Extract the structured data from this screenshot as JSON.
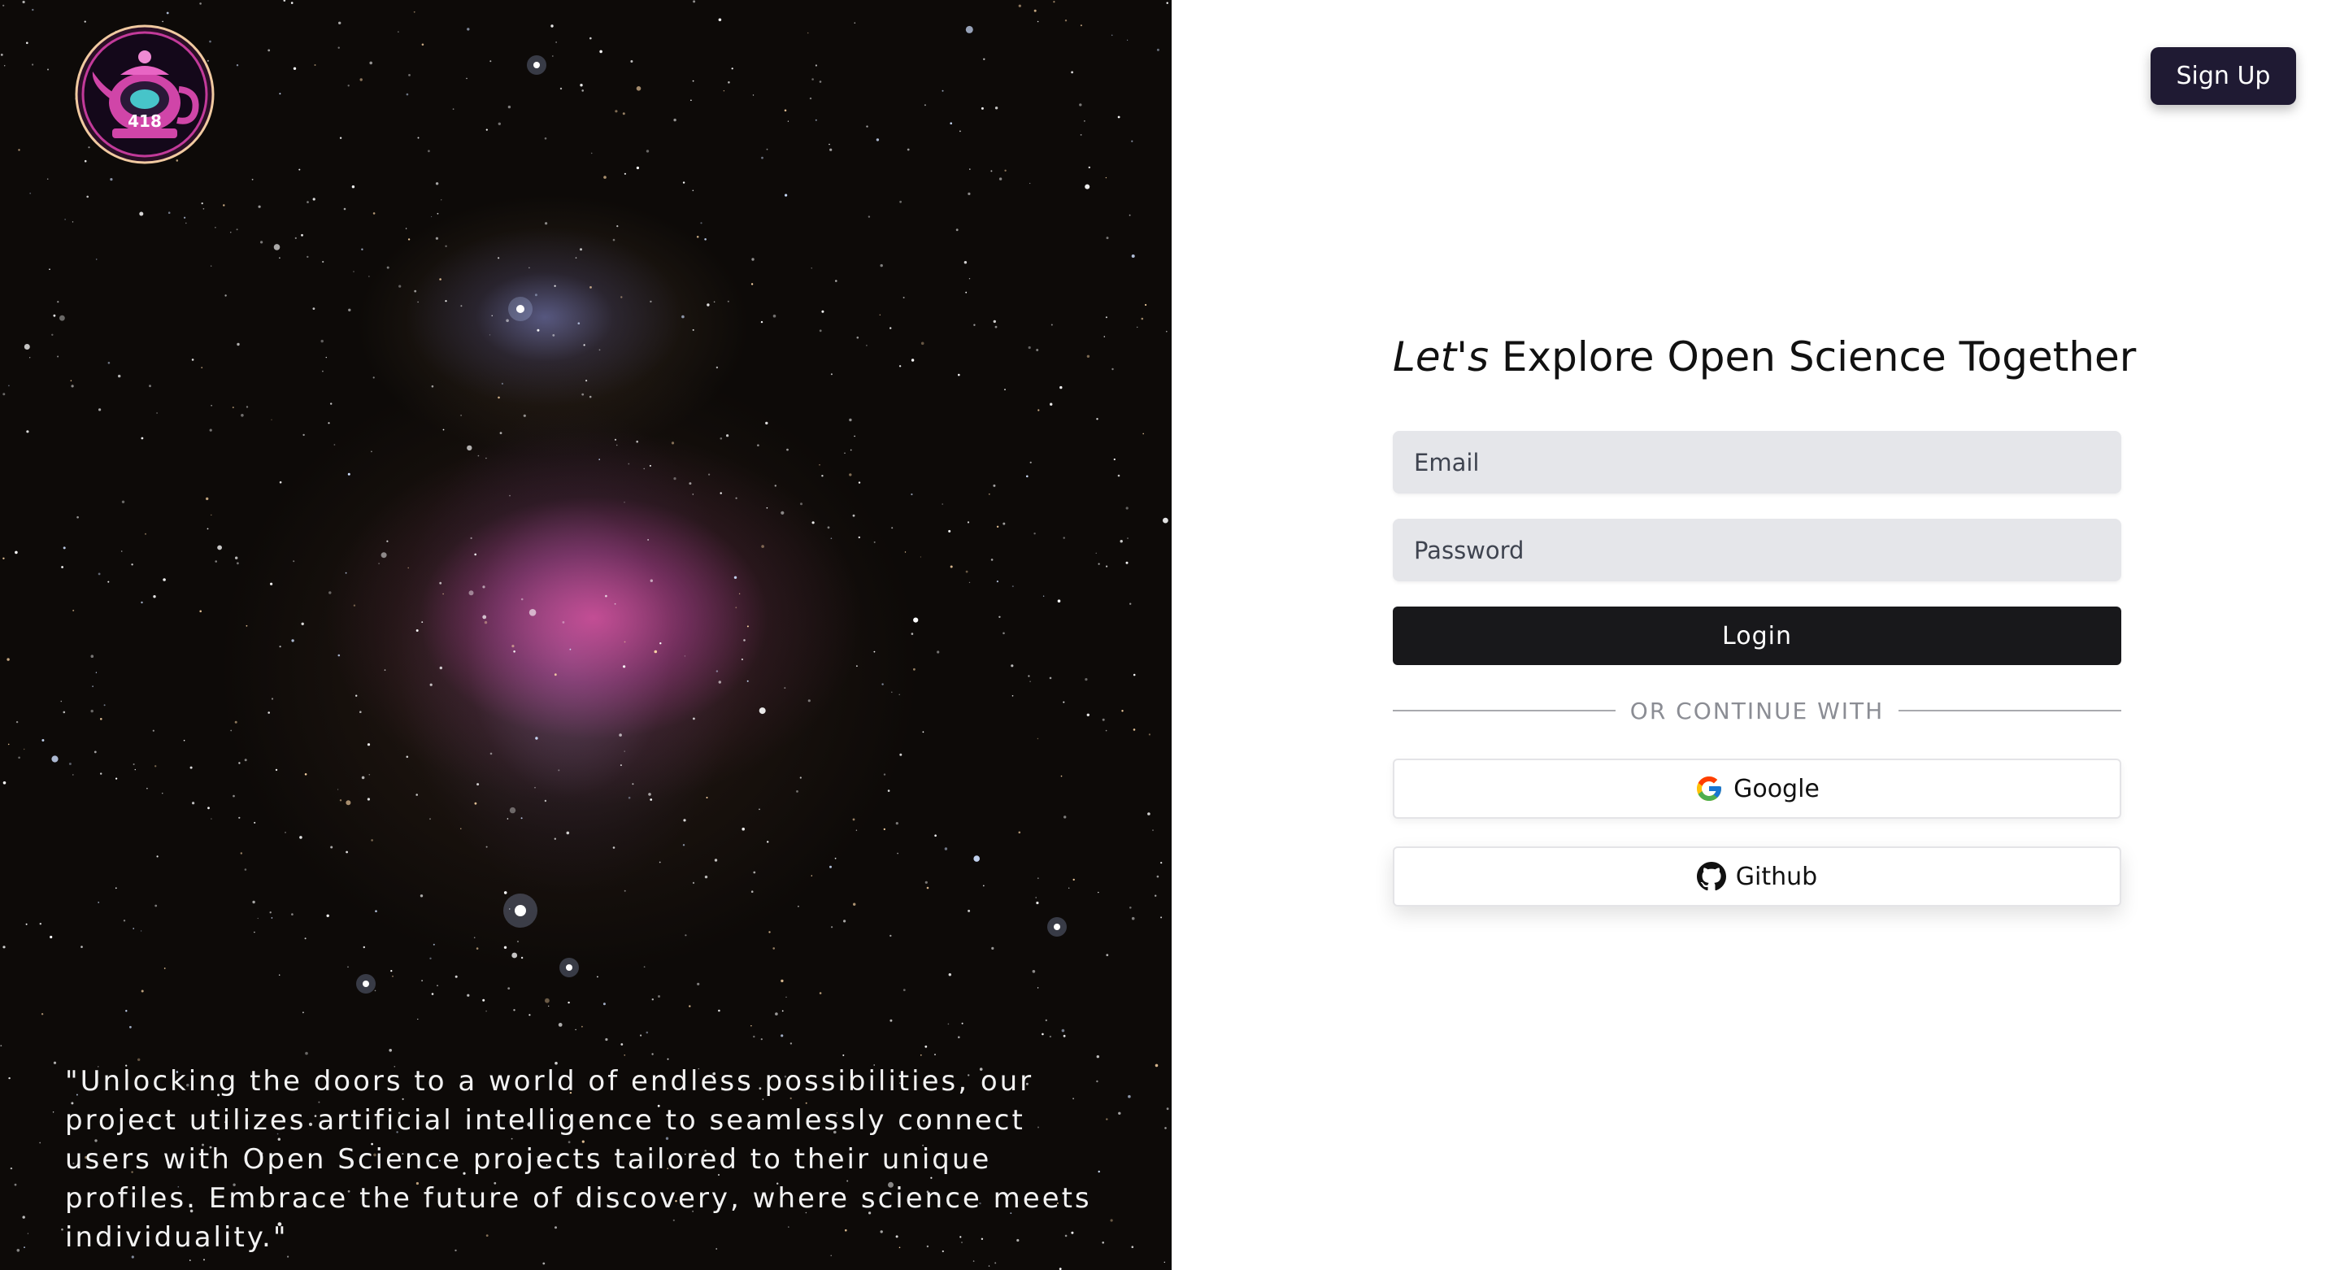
{
  "hero": {
    "logo_icon": "teapot-logo-icon",
    "logo_text": "418",
    "quote": "\"Unlocking the doors to a world of endless possibilities, our project utilizes artificial intelligence to seamlessly connect users with Open Science projects tailored to their unique profiles. Embrace the future of discovery, where science meets individuality.\""
  },
  "header": {
    "signup_label": "Sign Up"
  },
  "form": {
    "headline_italic": "Let's",
    "headline_rest": " Explore Open Science Together",
    "email_placeholder": "Email",
    "password_placeholder": "Password",
    "login_label": "Login",
    "divider_label": "OR CONTINUE WITH",
    "google_label": "Google",
    "google_icon": "google-icon",
    "github_label": "Github",
    "github_icon": "github-icon"
  },
  "colors": {
    "signup_bg": "#1f1a33",
    "login_bg": "#18181b",
    "input_bg": "#e5e6ea",
    "divider_text": "#8b8d94"
  }
}
